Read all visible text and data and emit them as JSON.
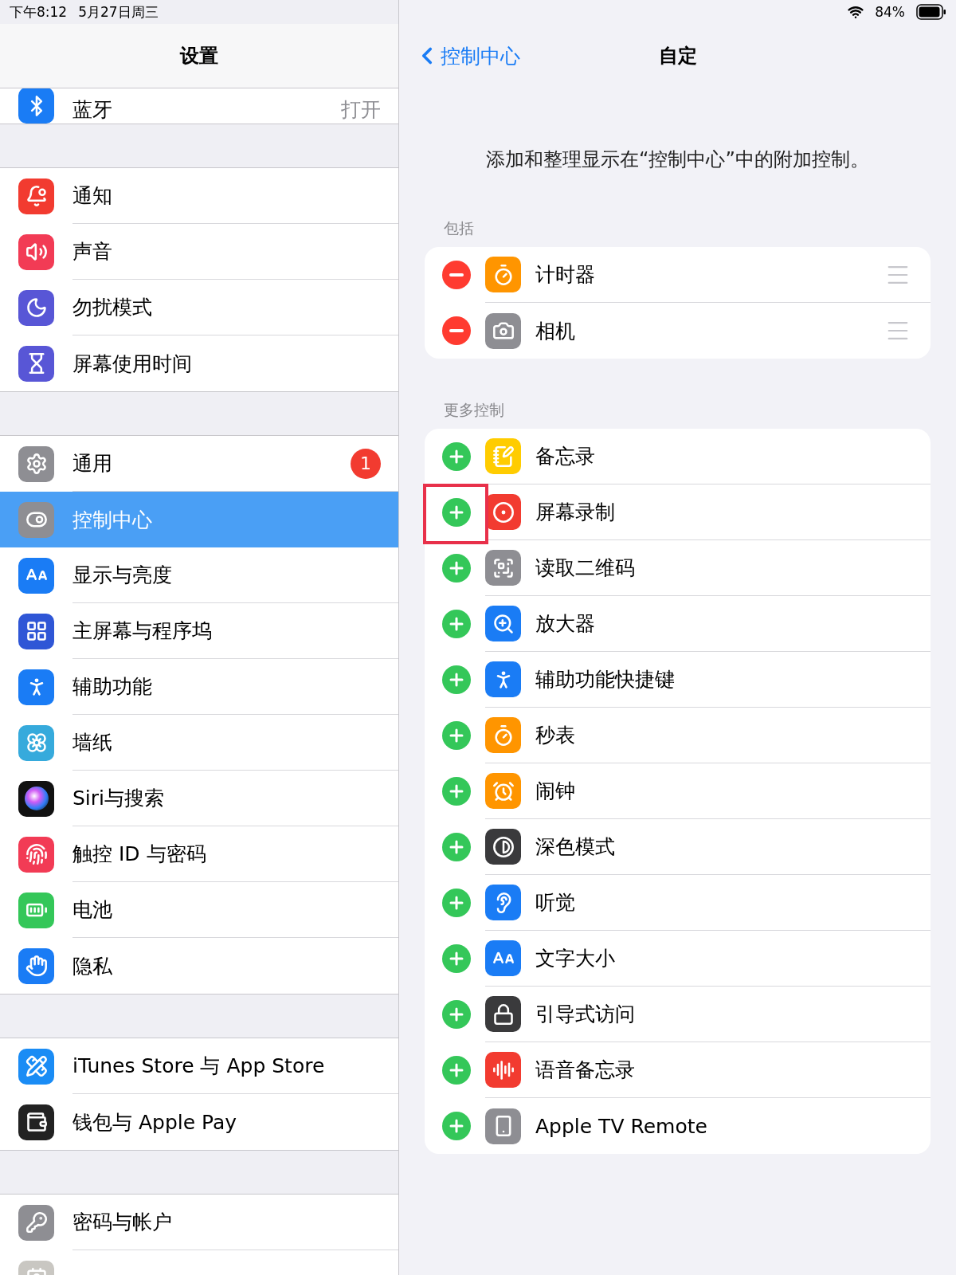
{
  "status_bar": {
    "time": "下午8:12",
    "date": "5月27日周三",
    "battery": "84%"
  },
  "sidebar": {
    "title": "设置",
    "groups": [
      {
        "kind": "partial",
        "items": [
          {
            "label": "蓝牙",
            "value": "打开",
            "selected": false
          }
        ]
      },
      {
        "kind": "full",
        "items": [
          {
            "label": "通知",
            "selected": false
          },
          {
            "label": "声音",
            "selected": false
          },
          {
            "label": "勿扰模式",
            "selected": false
          },
          {
            "label": "屏幕使用时间",
            "selected": false
          }
        ]
      },
      {
        "kind": "full",
        "items": [
          {
            "label": "通用",
            "badge": "1",
            "selected": false
          },
          {
            "label": "控制中心",
            "selected": true
          },
          {
            "label": "显示与亮度",
            "selected": false
          },
          {
            "label": "主屏幕与程序坞",
            "selected": false
          },
          {
            "label": "辅助功能",
            "selected": false
          },
          {
            "label": "墙纸",
            "selected": false
          },
          {
            "label": "Siri与搜索",
            "selected": false
          },
          {
            "label": "触控 ID 与密码",
            "selected": false
          },
          {
            "label": "电池",
            "selected": false
          },
          {
            "label": "隐私",
            "selected": false
          }
        ]
      },
      {
        "kind": "full",
        "items": [
          {
            "label": "iTunes Store 与 App Store",
            "selected": false
          },
          {
            "label": "钱包与 Apple Pay",
            "selected": false
          }
        ]
      },
      {
        "kind": "full",
        "items": [
          {
            "label": "密码与帐户",
            "selected": false
          },
          {
            "selected": false
          }
        ]
      }
    ]
  },
  "detail": {
    "back": "控制中心",
    "title": "自定",
    "description": "添加和整理显示在“控制中心”中的附加控制。",
    "sections": [
      {
        "header": "包括",
        "kind": "included",
        "items": [
          {
            "label": "计时器",
            "highlighted": false
          },
          {
            "label": "相机",
            "highlighted": false
          }
        ]
      },
      {
        "header": "更多控制",
        "kind": "more",
        "items": [
          {
            "label": "备忘录",
            "highlighted": false
          },
          {
            "label": "屏幕录制",
            "highlighted": true
          },
          {
            "label": "读取二维码",
            "highlighted": false
          },
          {
            "label": "放大器",
            "highlighted": false
          },
          {
            "label": "辅助功能快捷键",
            "highlighted": false
          },
          {
            "label": "秒表",
            "highlighted": false
          },
          {
            "label": "闹钟",
            "highlighted": false
          },
          {
            "label": "深色模式",
            "highlighted": false
          },
          {
            "label": "听觉",
            "highlighted": false
          },
          {
            "label": "文字大小",
            "highlighted": false
          },
          {
            "label": "引导式访问",
            "highlighted": false
          },
          {
            "label": "语音备忘录",
            "highlighted": false
          },
          {
            "label": "Apple TV Remote",
            "highlighted": false
          }
        ]
      }
    ]
  }
}
